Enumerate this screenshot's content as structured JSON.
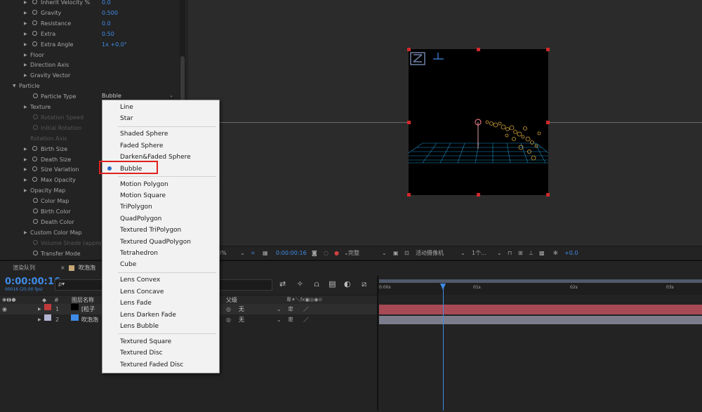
{
  "effects": {
    "properties": [
      {
        "label": "Inherit Velocity %",
        "value": "0.0",
        "stopwatch": true,
        "twirl": "▶",
        "indent": 1
      },
      {
        "label": "Gravity",
        "value": "0.500",
        "stopwatch": true,
        "twirl": "▶",
        "indent": 1
      },
      {
        "label": "Resistance",
        "value": "0.0",
        "stopwatch": true,
        "twirl": "▶",
        "indent": 1
      },
      {
        "label": "Extra",
        "value": "0.50",
        "stopwatch": true,
        "twirl": "▶",
        "indent": 1
      },
      {
        "label": "Extra Angle",
        "value": "1x +0.0°",
        "stopwatch": true,
        "twirl": "▶",
        "indent": 1
      },
      {
        "label": "Floor",
        "value": "",
        "stopwatch": false,
        "twirl": "▶",
        "indent": 1
      },
      {
        "label": "Direction Axis",
        "value": "",
        "stopwatch": false,
        "twirl": "▶",
        "indent": 1
      },
      {
        "label": "Gravity Vector",
        "value": "",
        "stopwatch": false,
        "twirl": "▶",
        "indent": 1
      },
      {
        "label": "Particle",
        "value": "",
        "stopwatch": false,
        "twirl": "▼",
        "indent": 0
      },
      {
        "label": "Particle Type",
        "value": "",
        "stopwatch": true,
        "twirl": "",
        "indent": 2
      },
      {
        "label": "Texture",
        "value": "",
        "stopwatch": false,
        "twirl": "▶",
        "indent": 1
      },
      {
        "label": "Rotation Speed",
        "value": "",
        "stopwatch": true,
        "twirl": "",
        "indent": 2,
        "dim": true
      },
      {
        "label": "Initial Rotation",
        "value": "",
        "stopwatch": true,
        "twirl": "",
        "indent": 2,
        "dim": true
      },
      {
        "label": "Rotation Axis",
        "value": "",
        "stopwatch": false,
        "twirl": "",
        "indent": 2,
        "dim": true
      },
      {
        "label": "Birth Size",
        "value": "",
        "stopwatch": true,
        "twirl": "▶",
        "indent": 1
      },
      {
        "label": "Death Size",
        "value": "",
        "stopwatch": true,
        "twirl": "▶",
        "indent": 1
      },
      {
        "label": "Size Variation",
        "value": "",
        "stopwatch": true,
        "twirl": "▶",
        "indent": 1
      },
      {
        "label": "Max Opacity",
        "value": "",
        "stopwatch": true,
        "twirl": "▶",
        "indent": 1
      },
      {
        "label": "Opacity Map",
        "value": "",
        "stopwatch": false,
        "twirl": "▶",
        "indent": 1
      },
      {
        "label": "Color Map",
        "value": "",
        "stopwatch": true,
        "twirl": "",
        "indent": 2
      },
      {
        "label": "Birth Color",
        "value": "",
        "stopwatch": true,
        "twirl": "",
        "indent": 2
      },
      {
        "label": "Death Color",
        "value": "",
        "stopwatch": true,
        "twirl": "",
        "indent": 2
      },
      {
        "label": "Custom Color Map",
        "value": "",
        "stopwatch": false,
        "twirl": "▶",
        "indent": 1
      },
      {
        "label": "Volume Shade (appro",
        "value": "",
        "stopwatch": true,
        "twirl": "",
        "indent": 2,
        "dim": true
      },
      {
        "label": "Transfer Mode",
        "value": "",
        "stopwatch": true,
        "twirl": "",
        "indent": 2
      }
    ],
    "particle_type_value": "Bubble"
  },
  "menu": {
    "groups": [
      [
        "Line",
        "Star"
      ],
      [
        "Shaded Sphere",
        "Faded Sphere",
        "Darken&Faded Sphere",
        "Bubble"
      ],
      [
        "Motion Polygon",
        "Motion Square",
        "TriPolygon",
        "QuadPolygon",
        "Textured TriPolygon",
        "Textured QuadPolygon",
        "Tetrahedron",
        "Cube"
      ],
      [
        "Lens Convex",
        "Lens Concave",
        "Lens Fade",
        "Lens Darken Fade",
        "Lens Bubble"
      ],
      [
        "Textured Square",
        "Textured Disc",
        "Textured Faded Disc"
      ]
    ],
    "selected": "Bubble"
  },
  "viewer_toolbar": {
    "zoom": "0%",
    "timecode": "0:00:00:16",
    "resolution": "完整",
    "camera": "活动摄像机",
    "views": "1个...",
    "exposure": "+0.0"
  },
  "timeline": {
    "tabs": [
      "渲染队列",
      "吹泡泡"
    ],
    "timecode": "0:00:00:16",
    "fps": "00016 (25.00 fps)",
    "search_placeholder": "ρ▾",
    "columns": {
      "num": "#",
      "name": "图层名称",
      "parent": "父级"
    },
    "layers": [
      {
        "num": "1",
        "name": "[粒子",
        "color": "#c0393b",
        "parent": "无"
      },
      {
        "num": "2",
        "name": "吹泡泡",
        "color": "#b3b4d2",
        "parent": "无"
      }
    ],
    "ruler": [
      "0:00s",
      "01s",
      "02s",
      "03s"
    ]
  },
  "colors": {
    "accent": "#3f8be6",
    "highlight": "#e02020",
    "track1": "#a74a55",
    "track2": "#7b7d8c"
  }
}
